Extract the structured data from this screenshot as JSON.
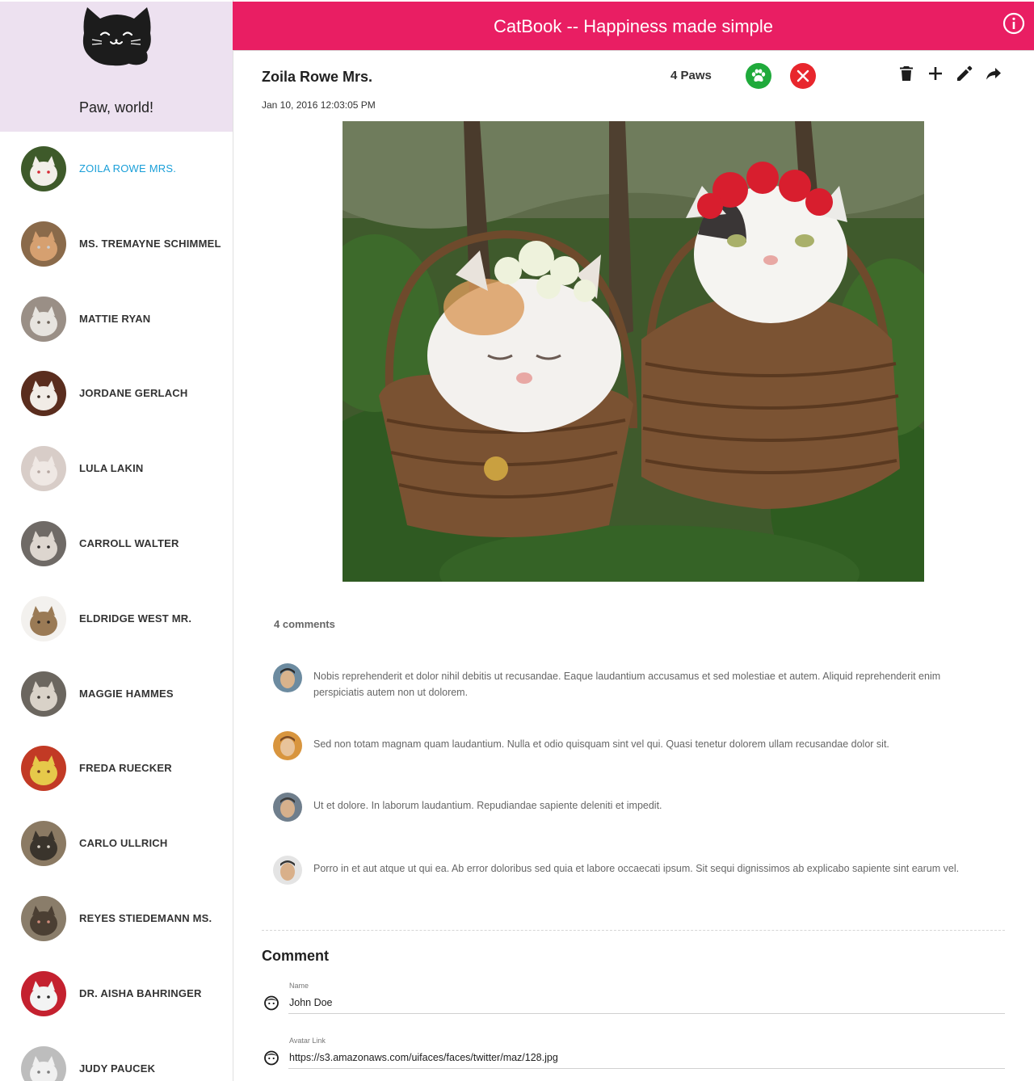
{
  "app": {
    "title": "CatBook -- Happiness made simple",
    "greeting": "Paw, world!",
    "accent_color": "#e91e63",
    "sidebar_header_color": "#ede1f0",
    "active_color": "#1a9fd8"
  },
  "sidebar": {
    "cats": [
      {
        "name": "Zoila Rowe Mrs.",
        "active": true
      },
      {
        "name": "Ms. Tremayne Schimmel"
      },
      {
        "name": "Mattie Ryan"
      },
      {
        "name": "Jordane Gerlach"
      },
      {
        "name": "Lula Lakin"
      },
      {
        "name": "Carroll Walter"
      },
      {
        "name": "Eldridge West Mr."
      },
      {
        "name": "Maggie Hammes"
      },
      {
        "name": "Freda Ruecker"
      },
      {
        "name": "Carlo Ullrich"
      },
      {
        "name": "Reyes Stiedemann Ms."
      },
      {
        "name": "Dr. Aisha Bahringer"
      },
      {
        "name": "Judy Paucek"
      }
    ]
  },
  "post": {
    "title": "Zoila Rowe Mrs.",
    "date": "Jan 10, 2016 12:03:05 PM",
    "paws": "4 Paws",
    "toolbar_icons": [
      "delete-icon",
      "add-icon",
      "edit-icon",
      "share-icon"
    ],
    "paw_button_color": "#1faa3b",
    "reject_button_color": "#e8262d"
  },
  "comments": {
    "count_label": "4 comments",
    "items": [
      {
        "text": "Nobis reprehenderit et dolor nihil debitis ut recusandae. Eaque laudantium accusamus et sed molestiae et autem. Aliquid reprehenderit enim perspiciatis autem non ut dolorem."
      },
      {
        "text": "Sed non totam magnam quam laudantium. Nulla et odio quisquam sint vel qui. Quasi tenetur dolorem ullam recusandae dolor sit."
      },
      {
        "text": "Ut et dolore. In laborum laudantium. Repudiandae sapiente deleniti et impedit."
      },
      {
        "text": "Porro in et aut atque ut qui ea. Ab error doloribus sed quia et labore occaecati ipsum. Sit sequi dignissimos ab explicabo sapiente sint earum vel."
      }
    ]
  },
  "comment_form": {
    "heading": "Comment",
    "name_label": "Name",
    "name_value": "John Doe",
    "avatar_label": "Avatar Link",
    "avatar_value": "https://s3.amazonaws.com/uifaces/faces/twitter/maz/128.jpg"
  }
}
